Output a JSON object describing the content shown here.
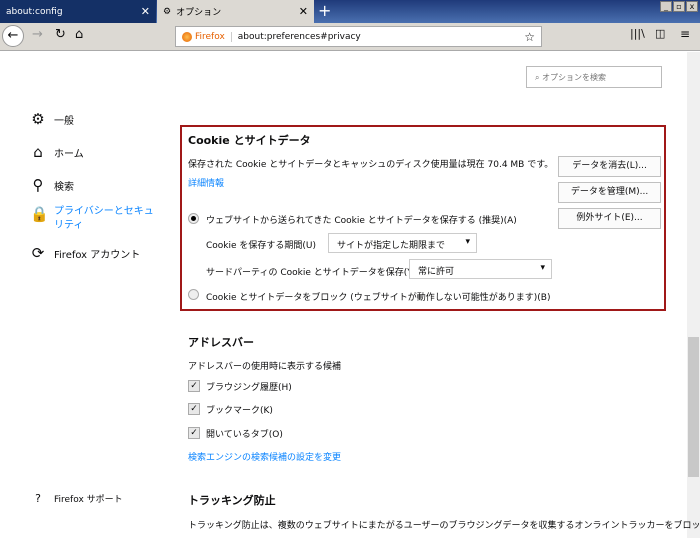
{
  "tabs": [
    {
      "label": "about:config"
    },
    {
      "label": "オプション"
    }
  ],
  "window_controls": [
    "_",
    "▫",
    "x"
  ],
  "urlbar": {
    "identity": "Firefox",
    "url": "about:preferences#privacy"
  },
  "search": {
    "placeholder": "オプションを検索"
  },
  "sidebar": {
    "items": [
      {
        "label": "一般",
        "icon": "gear-icon"
      },
      {
        "label": "ホーム",
        "icon": "home-icon"
      },
      {
        "label": "検索",
        "icon": "search-icon"
      },
      {
        "label": "プライバシーとセキュリティ",
        "icon": "lock-icon",
        "active": true
      },
      {
        "label": "Firefox アカウント",
        "icon": "sync-icon"
      }
    ],
    "support": "Firefox サポート"
  },
  "cookies": {
    "title": "Cookie とサイトデータ",
    "usage": "保存された Cookie とサイトデータとキャッシュのディスク使用量は現在 70.4 MB です。",
    "learn_more": "詳細情報",
    "clear": "データを消去(L)...",
    "manage": "データを管理(M)...",
    "exceptions": "例外サイト(E)...",
    "accept": "ウェブサイトから送られてきた Cookie とサイトデータを保存する (推奨)(A)",
    "keep_label": "Cookie を保存する期間(U)",
    "keep_value": "サイトが指定した期限まで",
    "third_label": "サードパーティの Cookie とサイトデータを保存(Y)",
    "third_value": "常に許可",
    "block": "Cookie とサイトデータをブロック (ウェブサイトが動作しない可能性があります)(B)"
  },
  "addressbar": {
    "title": "アドレスバー",
    "desc": "アドレスバーの使用時に表示する候補",
    "options": [
      {
        "label": "ブラウジング履歴(H)",
        "checked": true
      },
      {
        "label": "ブックマーク(K)",
        "checked": true
      },
      {
        "label": "開いているタブ(O)",
        "checked": true
      }
    ],
    "link": "検索エンジンの検索候補の設定を変更"
  },
  "tracking": {
    "title": "トラッキング防止",
    "desc": "トラッキング防止は、複数のウェブサイトにまたがるユーザーのブラウジングデータを収集するオンライントラッカーをブロックし"
  }
}
